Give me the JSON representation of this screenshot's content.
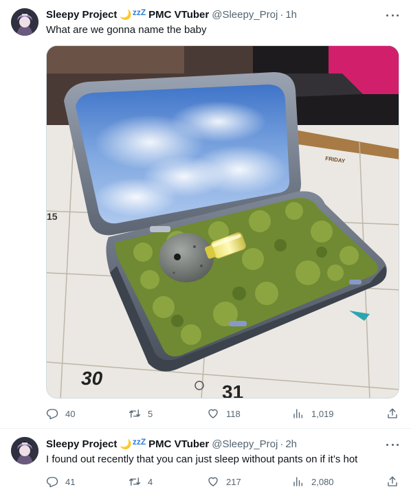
{
  "tweets": [
    {
      "author_name": "Sleepy Project",
      "moon_emoji": "🌙",
      "zzz": "zzZ",
      "suffix": "PMC VTuber",
      "handle": "@Sleepy_Proj",
      "separator": "·",
      "time": "1h",
      "text": "What are we gonna name the baby",
      "replies": "40",
      "retweets": "5",
      "likes": "118",
      "views": "1,019"
    },
    {
      "author_name": "Sleepy Project",
      "moon_emoji": "🌙",
      "zzz": "zzZ",
      "suffix": "PMC VTuber",
      "handle": "@Sleepy_Proj",
      "separator": "·",
      "time": "2h",
      "text": "I found out recently that you can just sleep without pants on if it’s hot",
      "replies": "41",
      "retweets": "4",
      "likes": "217",
      "views": "2,080"
    }
  ],
  "media": {
    "calendar_numbers": [
      "15",
      "30",
      "31"
    ],
    "calendar_day_label": "FRIDAY"
  },
  "icons": {
    "reply": "reply-icon",
    "retweet": "retweet-icon",
    "like": "like-icon",
    "views": "views-icon",
    "share": "share-icon",
    "more": "more-icon"
  }
}
